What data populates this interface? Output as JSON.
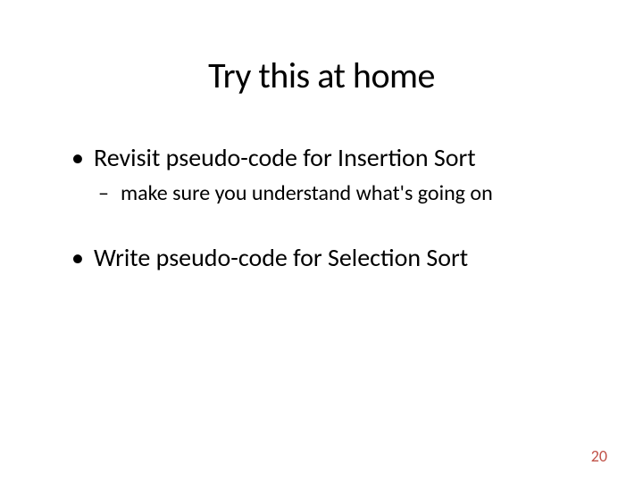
{
  "slide": {
    "title": "Try this at home",
    "bullets": [
      {
        "level": 1,
        "text": "Revisit pseudo-code for Insertion Sort"
      },
      {
        "level": 2,
        "text": "make sure you understand what's going on"
      },
      {
        "level": 1,
        "text": "Write pseudo-code for Selection Sort"
      }
    ],
    "page_number": "20"
  }
}
